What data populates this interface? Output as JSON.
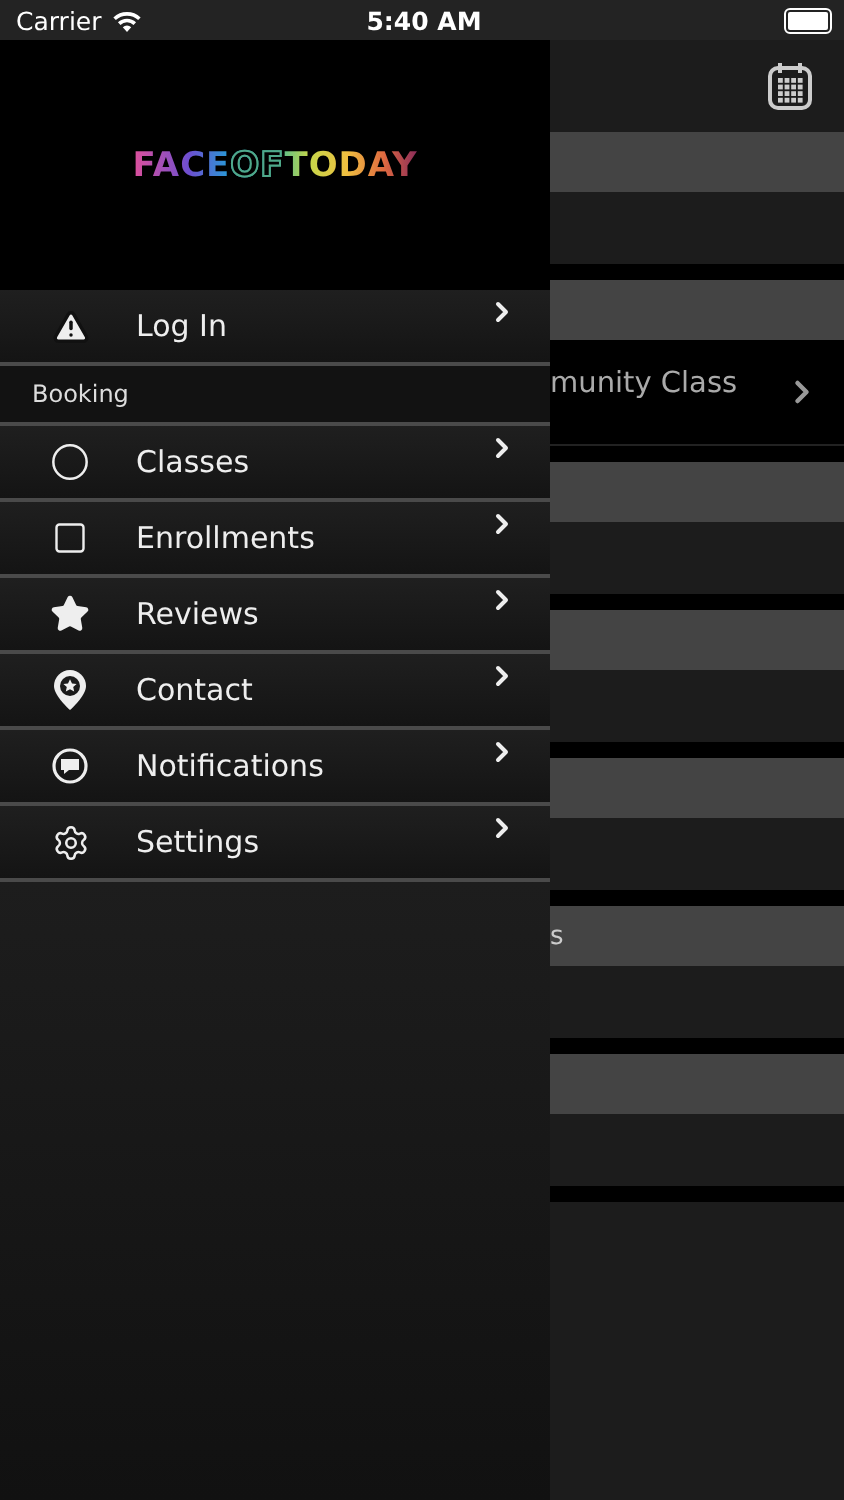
{
  "status_bar": {
    "carrier": "Carrier",
    "time": "5:40 AM"
  },
  "drawer": {
    "logo": [
      {
        "text": "FACE",
        "outline": false
      },
      {
        "text": "OF",
        "outline": true
      },
      {
        "text": "TODAY",
        "outline": false
      }
    ],
    "items": [
      {
        "kind": "item",
        "label": "Log In"
      },
      {
        "kind": "header",
        "label": "Booking"
      },
      {
        "kind": "item",
        "label": "Classes"
      },
      {
        "kind": "item",
        "label": "Enrollments"
      },
      {
        "kind": "item",
        "label": "Reviews"
      },
      {
        "kind": "item",
        "label": "Contact"
      },
      {
        "kind": "item",
        "label": "Notifications"
      },
      {
        "kind": "item",
        "label": "Settings"
      }
    ]
  },
  "background": {
    "sections": [
      {
        "kind": "empty"
      },
      {
        "kind": "item",
        "row": "munity Class"
      },
      {
        "kind": "empty"
      },
      {
        "kind": "empty"
      },
      {
        "kind": "empty"
      },
      {
        "kind": "empty",
        "header": "s"
      },
      {
        "kind": "empty"
      }
    ]
  }
}
